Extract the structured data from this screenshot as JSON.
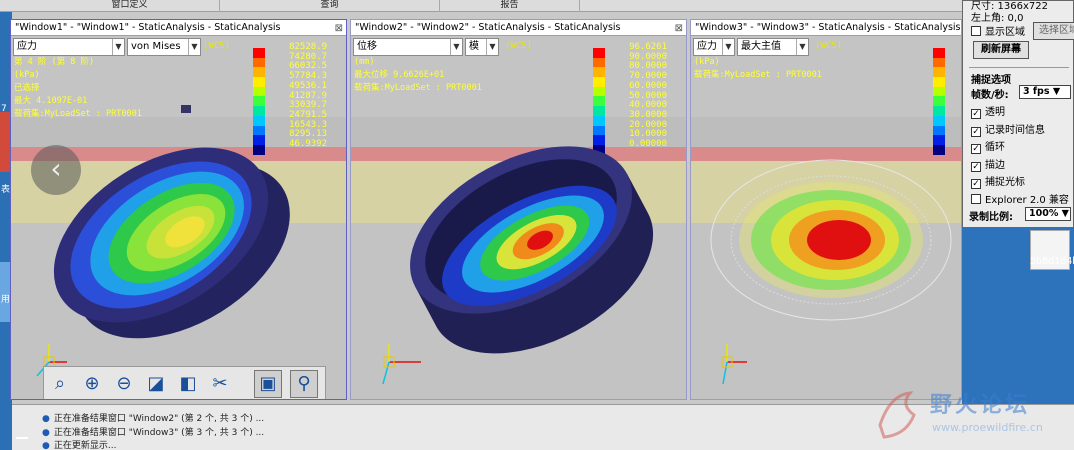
{
  "menu": [
    "窗口定义",
    "查询",
    "报告"
  ],
  "left_strip": {
    "labels": [
      "7",
      "表",
      "用"
    ]
  },
  "windows": [
    {
      "title": "\"Window1\" - \"Window1\" - StaticAnalysis - StaticAnalysis",
      "close": "⊠",
      "quantity": "应力",
      "component": "von Mises",
      "wcs": "(WCS)",
      "info": [
        "第 4 阶 (第 8 阶)",
        "(kPa)",
        "已选择",
        "最大 4.1097E-01",
        "载荷集:MyLoadSet : PRT0001"
      ],
      "legend_values": [
        "82528.9",
        "74280.7",
        "66032.5",
        "57784.3",
        "49536.1",
        "41287.9",
        "33039.7",
        "24791.5",
        "16543.3",
        "8295.13",
        "46.9392"
      ]
    },
    {
      "title": "\"Window2\" - \"Window2\" - StaticAnalysis - StaticAnalysis",
      "close": "⊠",
      "quantity": "位移",
      "component": "模",
      "wcs": "(WCS)",
      "info": [
        "(mm)",
        "最大位移    9.6626E+01",
        "载荷集:MyLoadSet : PRT0001"
      ],
      "legend_values": [
        "96.6261",
        "90.0000",
        "80.0000",
        "70.0000",
        "60.0000",
        "50.0000",
        "40.0000",
        "30.0000",
        "20.0000",
        "10.0000",
        "0.00000"
      ]
    },
    {
      "title": "\"Window3\" - \"Window3\" - StaticAnalysis - StaticAnalysis",
      "close": "⊠",
      "quantity": "应力",
      "component": "最大主值",
      "wcs": "(WCS)",
      "info": [
        "(kPa)",
        "载荷集:MyLoadSet : PRT0001"
      ],
      "legend_values": []
    }
  ],
  "legend_colors": [
    "#ff0000",
    "#ff6a00",
    "#ffb400",
    "#ffee00",
    "#b4ff00",
    "#3cff3c",
    "#00e8a0",
    "#00c8ff",
    "#0078ff",
    "#0020e8",
    "#000080"
  ],
  "nav": {
    "prev": "‹",
    "next": "›"
  },
  "messages": [
    "正在准备结果窗口 \"Window2\" (第 2 个, 共 3 个) ...",
    "正在准备结果窗口 \"Window3\" (第 3 个, 共 3 个) ...",
    "正在更新显示..."
  ],
  "capture_panel": {
    "size_label": "尺寸: 1366x722",
    "topleft_label": "左上角: 0,0",
    "show_region": "显示区域",
    "select_region": "选择区域",
    "refresh": "刷新屏幕",
    "options_title": "捕捉选项",
    "fps_label": "帧数/秒:",
    "fps_value": "3 fps",
    "options": [
      {
        "label": "透明",
        "checked": true
      },
      {
        "label": "记录时间信息",
        "checked": true
      },
      {
        "label": "循环",
        "checked": true
      },
      {
        "label": "描边",
        "checked": true
      },
      {
        "label": "捕捉光标",
        "checked": true
      },
      {
        "label": "Explorer 2.0 兼容",
        "checked": false
      }
    ],
    "ratio_label": "录制比例:",
    "ratio_value": "100%"
  },
  "desktop_icon_label": "5b8d1d4b",
  "watermark": {
    "title": "野火论坛",
    "url": "www.proewildfire.cn"
  }
}
